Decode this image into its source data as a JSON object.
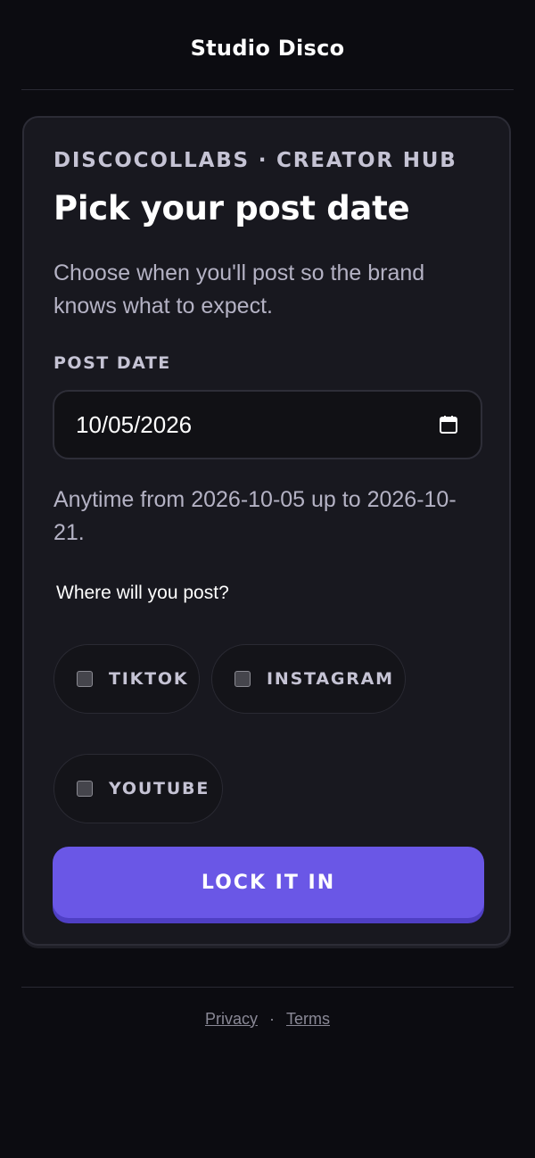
{
  "header": {
    "title": "Studio Disco"
  },
  "card": {
    "eyebrow": "DISCOCOLLABS · CREATOR HUB",
    "title": "Pick your post date",
    "description": "Choose when you'll post so the brand knows what to expect.",
    "post_date": {
      "label": "POST DATE",
      "value": "10/05/2026",
      "icon": "calendar-icon"
    },
    "hint": "Anytime from 2026-10-05 up to 2026-10-21.",
    "platforms": {
      "question": "Where will you post?",
      "options": [
        {
          "label": "TIKTOK",
          "checked": false
        },
        {
          "label": "INSTAGRAM",
          "checked": false
        },
        {
          "label": "YOUTUBE",
          "checked": false
        }
      ]
    },
    "submit_label": "LOCK IT IN"
  },
  "footer": {
    "privacy_label": "Privacy",
    "separator": "·",
    "terms_label": "Terms"
  },
  "colors": {
    "background": "#0c0c11",
    "card": "#18181f",
    "accent": "#6a57e6",
    "text_muted": "#b4b2c4"
  }
}
